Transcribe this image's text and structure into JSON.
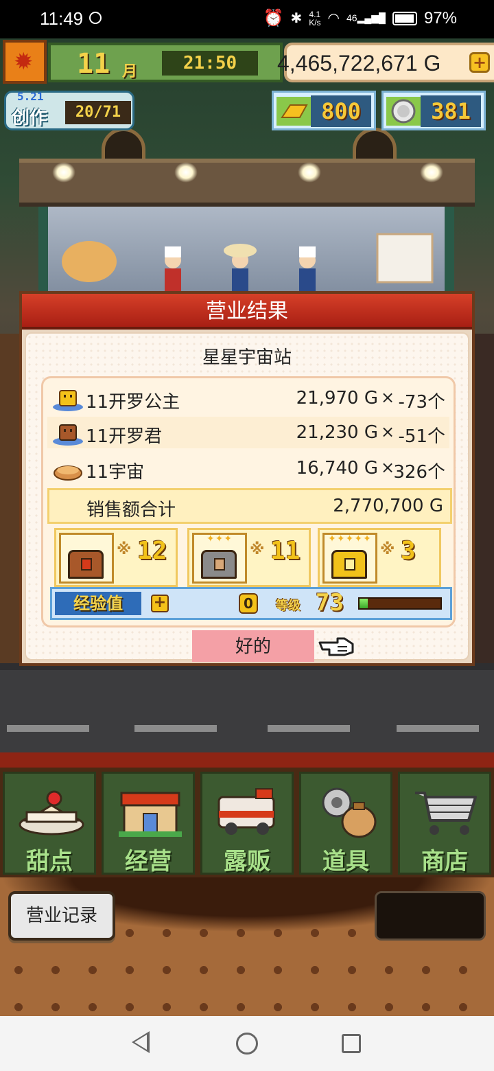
{
  "status_bar": {
    "time": "11:49",
    "net_speed_top": "4.1",
    "net_speed_bottom": "K/s",
    "signal": "46",
    "battery": "97%"
  },
  "hud": {
    "month_number": "11",
    "month_unit": "月",
    "clock": "21:50",
    "gold": "4,465,722,671 G",
    "gold_plus": "+",
    "create_date": "5.21",
    "create_label": "创作",
    "create_count": "20/71",
    "gold_bars": "800",
    "medals": "381"
  },
  "dialog": {
    "title": "营业结果",
    "shop_name": "星星宇宙站",
    "items": [
      {
        "name": "11开罗公主",
        "price": "21,970 G",
        "times": "×",
        "qty": "-73个",
        "icon": "princess-cake-icon",
        "icon_color": "#f4c21a"
      },
      {
        "name": "11开罗君",
        "price": "21,230 G",
        "times": "×",
        "qty": "-51个",
        "icon": "chocolate-cake-icon",
        "icon_color": "#a8582a"
      },
      {
        "name": "11宇宙",
        "price": "16,740 G",
        "times": "×",
        "qty": "326个",
        "icon": "pie-icon",
        "icon_color": "#d8904a"
      }
    ],
    "total_label": "销售额合计",
    "total_value": "2,770,700 G",
    "chests": [
      {
        "icon": "wooden-chest-icon",
        "mult": "※",
        "count": "12",
        "stars": "",
        "color": "#a8582a"
      },
      {
        "icon": "silver-chest-icon",
        "mult": "※",
        "count": "11",
        "stars": "✦✦✦",
        "color": "#8a8a8a"
      },
      {
        "icon": "gold-chest-icon",
        "mult": "※",
        "count": "3",
        "stars": "✦✦✦✦✦",
        "color": "#f2c21a"
      }
    ],
    "exp_label": "经验值",
    "exp_plus": "+",
    "exp_value": "0",
    "level_label": "等级",
    "level_value": "73",
    "level_progress": 0.1,
    "ok_label": "好的"
  },
  "menu": {
    "items": [
      {
        "label": "甜点",
        "icon": "cake-icon"
      },
      {
        "label": "经营",
        "icon": "shop-icon"
      },
      {
        "label": "露贩",
        "icon": "food-truck-icon"
      },
      {
        "label": "道具",
        "icon": "tools-bag-icon"
      },
      {
        "label": "商店",
        "icon": "cart-icon"
      }
    ]
  },
  "record_button": "营业记录",
  "colors": {
    "title_red": "#c22a18",
    "menu_green": "#3c5a30",
    "menu_text": "#a8e08a",
    "gold_text": "#f4d24a",
    "ok_pink": "#f4a0a6"
  }
}
